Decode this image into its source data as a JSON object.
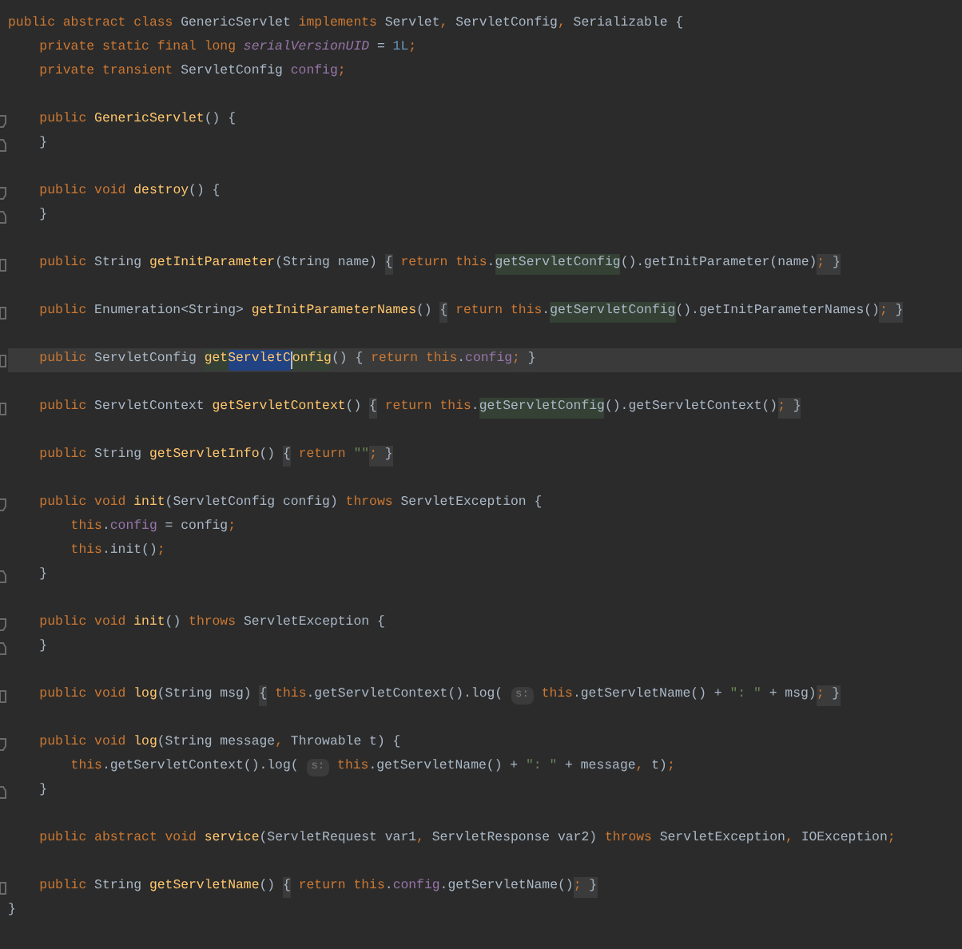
{
  "editor": {
    "lines": [
      {
        "kind": "plain",
        "tokens": [
          {
            "text": "public abstract class ",
            "kind": "keyword"
          },
          {
            "text": "GenericServlet ",
            "kind": "plain"
          },
          {
            "text": "implements ",
            "kind": "keyword"
          },
          {
            "text": "Servlet",
            "kind": "plain"
          },
          {
            "text": ", ",
            "kind": "punct"
          },
          {
            "text": "ServletConfig",
            "kind": "plain"
          },
          {
            "text": ", ",
            "kind": "punct"
          },
          {
            "text": "Serializable {",
            "kind": "plain"
          }
        ]
      },
      {
        "kind": "plain",
        "tokens": [
          {
            "text": "    private static final long ",
            "kind": "keyword"
          },
          {
            "text": "serialVersionUID",
            "kind": "static"
          },
          {
            "text": " = ",
            "kind": "plain"
          },
          {
            "text": "1L",
            "kind": "number"
          },
          {
            "text": ";",
            "kind": "punct"
          }
        ]
      },
      {
        "kind": "plain",
        "tokens": [
          {
            "text": "    private transient ",
            "kind": "keyword"
          },
          {
            "text": "ServletConfig ",
            "kind": "plain"
          },
          {
            "text": "config",
            "kind": "field"
          },
          {
            "text": ";",
            "kind": "punct"
          }
        ]
      },
      {
        "kind": "blank"
      },
      {
        "kind": "fold_open",
        "tokens": [
          {
            "text": "    public ",
            "kind": "keyword"
          },
          {
            "text": "GenericServlet",
            "kind": "method"
          },
          {
            "text": "() {",
            "kind": "plain"
          }
        ]
      },
      {
        "kind": "fold_close",
        "tokens": [
          {
            "text": "    }",
            "kind": "plain"
          }
        ]
      },
      {
        "kind": "blank"
      },
      {
        "kind": "fold_open",
        "tokens": [
          {
            "text": "    public void ",
            "kind": "keyword"
          },
          {
            "text": "destroy",
            "kind": "method"
          },
          {
            "text": "() {",
            "kind": "plain"
          }
        ]
      },
      {
        "kind": "fold_close",
        "tokens": [
          {
            "text": "    }",
            "kind": "plain"
          }
        ]
      },
      {
        "kind": "blank"
      },
      {
        "kind": "collapsed",
        "tokens": [
          {
            "text": "    public ",
            "kind": "keyword"
          },
          {
            "text": "String ",
            "kind": "plain"
          },
          {
            "text": "getInitParameter",
            "kind": "method"
          },
          {
            "text": "(String name) ",
            "kind": "plain"
          },
          {
            "text": "{",
            "kind": "plain",
            "fold": true
          },
          {
            "text": " return this",
            "kind": "keyword"
          },
          {
            "text": ".",
            "kind": "plain"
          },
          {
            "text": "getServletConfig",
            "kind": "plain",
            "usage": true
          },
          {
            "text": "().getInitParameter(name)",
            "kind": "plain"
          },
          {
            "text": ";",
            "kind": "punct",
            "fold": true
          },
          {
            "text": " }",
            "kind": "plain",
            "fold": true
          }
        ]
      },
      {
        "kind": "blank"
      },
      {
        "kind": "collapsed",
        "tokens": [
          {
            "text": "    public ",
            "kind": "keyword"
          },
          {
            "text": "Enumeration<String> ",
            "kind": "plain"
          },
          {
            "text": "getInitParameterNames",
            "kind": "method"
          },
          {
            "text": "() ",
            "kind": "plain"
          },
          {
            "text": "{",
            "kind": "plain",
            "fold": true
          },
          {
            "text": " return this",
            "kind": "keyword"
          },
          {
            "text": ".",
            "kind": "plain"
          },
          {
            "text": "getServletConfig",
            "kind": "plain",
            "usage": true
          },
          {
            "text": "().getInitParameterNames()",
            "kind": "plain"
          },
          {
            "text": ";",
            "kind": "punct",
            "fold": true
          },
          {
            "text": " }",
            "kind": "plain",
            "fold": true
          }
        ]
      },
      {
        "kind": "blank"
      },
      {
        "kind": "collapsed",
        "current": true,
        "tokens": [
          {
            "text": "    public ",
            "kind": "keyword"
          },
          {
            "text": "ServletConfig ",
            "kind": "plain"
          },
          {
            "text": "get",
            "kind": "method",
            "usage": true
          },
          {
            "text": "ServletC",
            "kind": "method",
            "selected": true
          },
          {
            "kind": "caret"
          },
          {
            "text": "onfig",
            "kind": "method",
            "usage": true
          },
          {
            "text": "() ",
            "kind": "plain"
          },
          {
            "text": "{",
            "kind": "plain",
            "fold": true
          },
          {
            "text": " return this",
            "kind": "keyword"
          },
          {
            "text": ".",
            "kind": "plain"
          },
          {
            "text": "config",
            "kind": "field"
          },
          {
            "text": ";",
            "kind": "punct",
            "fold": true
          },
          {
            "text": " }",
            "kind": "plain",
            "fold": true
          }
        ]
      },
      {
        "kind": "blank"
      },
      {
        "kind": "collapsed",
        "tokens": [
          {
            "text": "    public ",
            "kind": "keyword"
          },
          {
            "text": "ServletContext ",
            "kind": "plain"
          },
          {
            "text": "getServletContext",
            "kind": "method"
          },
          {
            "text": "() ",
            "kind": "plain"
          },
          {
            "text": "{",
            "kind": "plain",
            "fold": true
          },
          {
            "text": " return this",
            "kind": "keyword"
          },
          {
            "text": ".",
            "kind": "plain"
          },
          {
            "text": "getServletConfig",
            "kind": "plain",
            "usage": true
          },
          {
            "text": "().getServletContext()",
            "kind": "plain"
          },
          {
            "text": ";",
            "kind": "punct",
            "fold": true
          },
          {
            "text": " }",
            "kind": "plain",
            "fold": true
          }
        ]
      },
      {
        "kind": "blank"
      },
      {
        "kind": "plain",
        "tokens": [
          {
            "text": "    public ",
            "kind": "keyword"
          },
          {
            "text": "String ",
            "kind": "plain"
          },
          {
            "text": "getServletInfo",
            "kind": "method"
          },
          {
            "text": "() ",
            "kind": "plain"
          },
          {
            "text": "{",
            "kind": "plain",
            "fold": true
          },
          {
            "text": " return ",
            "kind": "keyword"
          },
          {
            "text": "\"\"",
            "kind": "string"
          },
          {
            "text": ";",
            "kind": "punct",
            "fold": true
          },
          {
            "text": " }",
            "kind": "plain",
            "fold": true
          }
        ]
      },
      {
        "kind": "blank"
      },
      {
        "kind": "fold_open",
        "tokens": [
          {
            "text": "    public void ",
            "kind": "keyword"
          },
          {
            "text": "init",
            "kind": "method"
          },
          {
            "text": "(ServletConfig config) ",
            "kind": "plain"
          },
          {
            "text": "throws ",
            "kind": "keyword"
          },
          {
            "text": "ServletException {",
            "kind": "plain"
          }
        ]
      },
      {
        "kind": "plain",
        "tokens": [
          {
            "text": "        this",
            "kind": "keyword"
          },
          {
            "text": ".",
            "kind": "plain"
          },
          {
            "text": "config",
            "kind": "field"
          },
          {
            "text": " = config",
            "kind": "plain"
          },
          {
            "text": ";",
            "kind": "punct"
          }
        ]
      },
      {
        "kind": "plain",
        "tokens": [
          {
            "text": "        this",
            "kind": "keyword"
          },
          {
            "text": ".init()",
            "kind": "plain"
          },
          {
            "text": ";",
            "kind": "punct"
          }
        ]
      },
      {
        "kind": "fold_close",
        "tokens": [
          {
            "text": "    }",
            "kind": "plain"
          }
        ]
      },
      {
        "kind": "blank"
      },
      {
        "kind": "fold_open",
        "tokens": [
          {
            "text": "    public void ",
            "kind": "keyword"
          },
          {
            "text": "init",
            "kind": "method"
          },
          {
            "text": "() ",
            "kind": "plain"
          },
          {
            "text": "throws ",
            "kind": "keyword"
          },
          {
            "text": "ServletException {",
            "kind": "plain"
          }
        ]
      },
      {
        "kind": "fold_close",
        "tokens": [
          {
            "text": "    }",
            "kind": "plain"
          }
        ]
      },
      {
        "kind": "blank"
      },
      {
        "kind": "collapsed",
        "tokens": [
          {
            "text": "    public void ",
            "kind": "keyword"
          },
          {
            "text": "log",
            "kind": "method"
          },
          {
            "text": "(String msg) ",
            "kind": "plain"
          },
          {
            "text": "{",
            "kind": "plain",
            "fold": true
          },
          {
            "text": " this",
            "kind": "keyword"
          },
          {
            "text": ".getServletContext().log( ",
            "kind": "plain"
          },
          {
            "text": "s:",
            "kind": "hint"
          },
          {
            "text": " this",
            "kind": "keyword"
          },
          {
            "text": ".getServletName() + ",
            "kind": "plain"
          },
          {
            "text": "\": \"",
            "kind": "string"
          },
          {
            "text": " + msg)",
            "kind": "plain"
          },
          {
            "text": ";",
            "kind": "punct",
            "fold": true
          },
          {
            "text": " }",
            "kind": "plain",
            "fold": true
          }
        ]
      },
      {
        "kind": "blank"
      },
      {
        "kind": "fold_open",
        "tokens": [
          {
            "text": "    public void ",
            "kind": "keyword"
          },
          {
            "text": "log",
            "kind": "method"
          },
          {
            "text": "(String message",
            "kind": "plain"
          },
          {
            "text": ", ",
            "kind": "punct"
          },
          {
            "text": "Throwable t) {",
            "kind": "plain"
          }
        ]
      },
      {
        "kind": "plain",
        "tokens": [
          {
            "text": "        this",
            "kind": "keyword"
          },
          {
            "text": ".getServletContext().log( ",
            "kind": "plain"
          },
          {
            "text": "s:",
            "kind": "hint"
          },
          {
            "text": " this",
            "kind": "keyword"
          },
          {
            "text": ".getServletName() + ",
            "kind": "plain"
          },
          {
            "text": "\": \"",
            "kind": "string"
          },
          {
            "text": " + message",
            "kind": "plain"
          },
          {
            "text": ", ",
            "kind": "punct"
          },
          {
            "text": "t)",
            "kind": "plain"
          },
          {
            "text": ";",
            "kind": "punct"
          }
        ]
      },
      {
        "kind": "fold_close",
        "tokens": [
          {
            "text": "    }",
            "kind": "plain"
          }
        ]
      },
      {
        "kind": "blank"
      },
      {
        "kind": "plain",
        "tokens": [
          {
            "text": "    public abstract void ",
            "kind": "keyword"
          },
          {
            "text": "service",
            "kind": "method"
          },
          {
            "text": "(ServletRequest var1",
            "kind": "plain"
          },
          {
            "text": ", ",
            "kind": "punct"
          },
          {
            "text": "ServletResponse var2) ",
            "kind": "plain"
          },
          {
            "text": "throws ",
            "kind": "keyword"
          },
          {
            "text": "ServletException",
            "kind": "plain"
          },
          {
            "text": ", ",
            "kind": "punct"
          },
          {
            "text": "IOException",
            "kind": "plain"
          },
          {
            "text": ";",
            "kind": "punct"
          }
        ]
      },
      {
        "kind": "blank"
      },
      {
        "kind": "collapsed",
        "tokens": [
          {
            "text": "    public ",
            "kind": "keyword"
          },
          {
            "text": "String ",
            "kind": "plain"
          },
          {
            "text": "getServletName",
            "kind": "method"
          },
          {
            "text": "() ",
            "kind": "plain"
          },
          {
            "text": "{",
            "kind": "plain",
            "fold": true
          },
          {
            "text": " return this",
            "kind": "keyword"
          },
          {
            "text": ".",
            "kind": "plain"
          },
          {
            "text": "config",
            "kind": "field"
          },
          {
            "text": ".getServletName()",
            "kind": "plain"
          },
          {
            "text": ";",
            "kind": "punct",
            "fold": true
          },
          {
            "text": " }",
            "kind": "plain",
            "fold": true
          }
        ]
      },
      {
        "kind": "plain",
        "tokens": [
          {
            "text": "}",
            "kind": "plain"
          }
        ]
      }
    ]
  }
}
